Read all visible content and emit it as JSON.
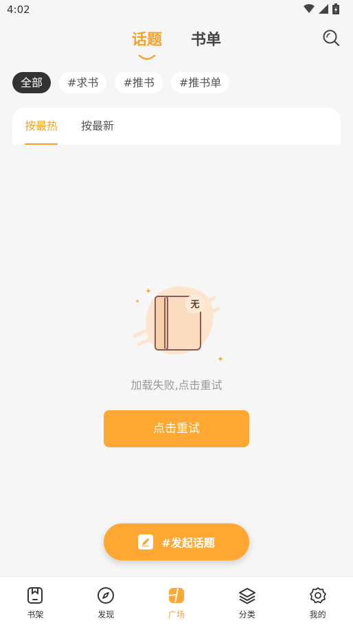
{
  "status_bar": {
    "time": "4:02"
  },
  "header": {
    "tabs": [
      {
        "label": "话题",
        "active": true
      },
      {
        "label": "书单",
        "active": false
      }
    ]
  },
  "chips": [
    {
      "label": "全部",
      "active": true
    },
    {
      "label": "#求书",
      "active": false
    },
    {
      "label": "#推书",
      "active": false
    },
    {
      "label": "#推书单",
      "active": false
    }
  ],
  "sort_tabs": [
    {
      "label": "按最热",
      "active": true
    },
    {
      "label": "按最新",
      "active": false
    }
  ],
  "empty_state": {
    "badge": "无",
    "message": "加载失败,点击重试",
    "retry_label": "点击重试"
  },
  "fab": {
    "label": "#发起话题"
  },
  "bottom_nav": [
    {
      "label": "书架",
      "icon": "bookshelf-icon",
      "active": false
    },
    {
      "label": "发现",
      "icon": "compass-icon",
      "active": false
    },
    {
      "label": "广场",
      "icon": "square-icon",
      "active": true
    },
    {
      "label": "分类",
      "icon": "layers-icon",
      "active": false
    },
    {
      "label": "我的",
      "icon": "gear-icon",
      "active": false
    }
  ],
  "colors": {
    "accent": "#ffa733",
    "accent_text": "#f5a32e",
    "chip_active": "#333333",
    "background": "#f6f6f6"
  }
}
